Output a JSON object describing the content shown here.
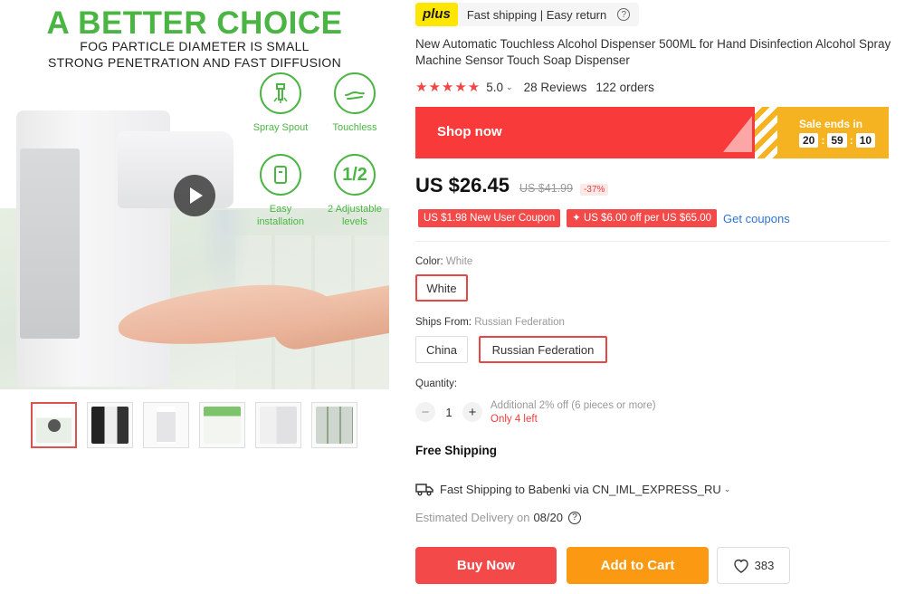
{
  "gallery": {
    "hero_title": "A BETTER CHOICE",
    "hero_sub1": "FOG PARTICLE DIAMETER IS SMALL",
    "hero_sub2": "STRONG PENETRATION AND FAST DIFFUSION",
    "features": [
      {
        "label": "Spray Spout",
        "icon": "spray-icon"
      },
      {
        "label": "Touchless",
        "icon": "hand-icon"
      },
      {
        "label": "Easy\ninstallation",
        "icon": "install-icon"
      },
      {
        "label": "2 Adjustable\nlevels",
        "icon_text": "1/2"
      }
    ],
    "thumbnail_count": 6
  },
  "plus": {
    "badge": "plus",
    "text": "Fast shipping | Easy return"
  },
  "product": {
    "title": "New Automatic Touchless Alcohol Dispenser 500ML for Hand Disinfection Alcohol Spray Machine Sensor Touch Soap Dispenser",
    "rating": "5.0",
    "stars": 5,
    "reviews": "28 Reviews",
    "orders": "122 orders"
  },
  "banner": {
    "label": "Shop now",
    "sale_label": "Sale ends in",
    "timer": [
      "20",
      "59",
      "10"
    ]
  },
  "price": {
    "current": "US $26.45",
    "original": "US $41.99",
    "discount": "-37%"
  },
  "coupons": {
    "items": [
      "US $1.98 New User Coupon",
      "✦ US $6.00 off per US $65.00"
    ],
    "get_label": "Get coupons"
  },
  "options": {
    "color_label": "Color:",
    "color_value": "White",
    "colors": [
      "White"
    ],
    "ships_label": "Ships From:",
    "ships_value": "Russian Federation",
    "ships_from": [
      "China",
      "Russian Federation"
    ],
    "quantity_label": "Quantity:",
    "quantity": "1",
    "qty_note": "Additional 2% off (6 pieces or more)",
    "stock": "Only 4 left"
  },
  "shipping": {
    "free": "Free Shipping",
    "method": "Fast Shipping",
    "destination": "to Babenki via CN_IML_EXPRESS_RU",
    "estimated_label": "Estimated Delivery on",
    "estimated_date": "08/20"
  },
  "actions": {
    "buy_now": "Buy Now",
    "add_to_cart": "Add to Cart",
    "wishlist_count": "383"
  },
  "colors": {
    "accent_red": "#f34949",
    "accent_orange": "#fb9a12",
    "plus_yellow": "#ffe600",
    "green": "#4bb543"
  }
}
